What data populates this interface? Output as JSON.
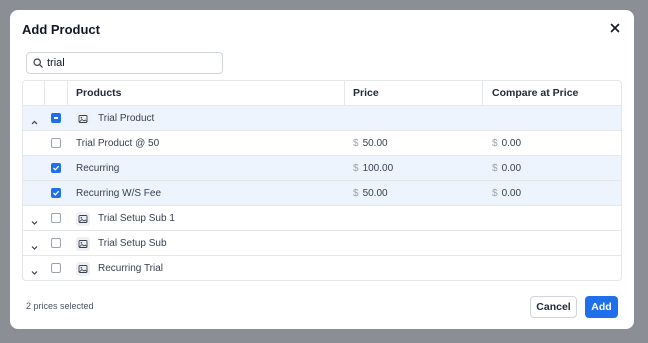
{
  "modal": {
    "title": "Add Product"
  },
  "search": {
    "value": "trial",
    "placeholder": ""
  },
  "table": {
    "headers": {
      "products": "Products",
      "price": "Price",
      "compare": "Compare at Price"
    },
    "currency_symbol": "$",
    "rows": [
      {
        "label": "Trial Product"
      },
      {
        "label": "Trial Product @ 50",
        "price": "50.00",
        "compare": "0.00"
      },
      {
        "label": "Recurring",
        "price": "100.00",
        "compare": "0.00"
      },
      {
        "label": "Recurring W/S Fee",
        "price": "50.00",
        "compare": "0.00"
      },
      {
        "label": "Trial Setup Sub 1"
      },
      {
        "label": "Trial Setup Sub"
      },
      {
        "label": "Recurring Trial"
      }
    ]
  },
  "footer": {
    "selected_text": "2 prices selected",
    "cancel_label": "Cancel",
    "add_label": "Add"
  },
  "colors": {
    "primary": "#1f6feb",
    "highlight_row": "#eef4fd",
    "overlay": "#8b8e95"
  }
}
